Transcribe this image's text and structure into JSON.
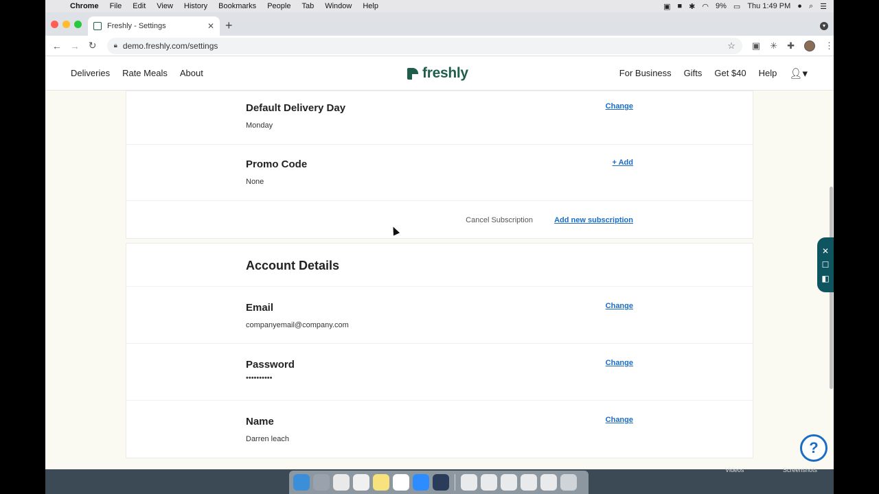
{
  "menubar": {
    "items": [
      "Chrome",
      "File",
      "Edit",
      "View",
      "History",
      "Bookmarks",
      "People",
      "Tab",
      "Window",
      "Help"
    ],
    "battery": "9%",
    "clock": "Thu 1:49 PM"
  },
  "browser": {
    "tab_title": "Freshly - Settings",
    "url": "demo.freshly.com/settings"
  },
  "site": {
    "logo": "freshly",
    "nav_left": [
      "Deliveries",
      "Rate Meals",
      "About"
    ],
    "nav_right": [
      "For Business",
      "Gifts",
      "Get $40",
      "Help"
    ]
  },
  "subscription": {
    "delivery_day": {
      "title": "Default Delivery Day",
      "value": "Monday",
      "action": "Change"
    },
    "promo": {
      "title": "Promo Code",
      "value": "None",
      "action": "+ Add"
    },
    "cancel_label": "Cancel Subscription",
    "add_label": "Add new subscription"
  },
  "account": {
    "title": "Account Details",
    "email": {
      "title": "Email",
      "value": "companyemail@company.com",
      "action": "Change"
    },
    "password": {
      "title": "Password",
      "value": "••••••••••",
      "action": "Change"
    },
    "name": {
      "title": "Name",
      "value": "Darren leach",
      "action": "Change"
    }
  },
  "help_widget": "?",
  "desktop_labels": [
    "Videos",
    "Screenshots"
  ],
  "colors": {
    "brand": "#1f5e4b",
    "link": "#1a6cc4",
    "widget": "#0e5560"
  }
}
